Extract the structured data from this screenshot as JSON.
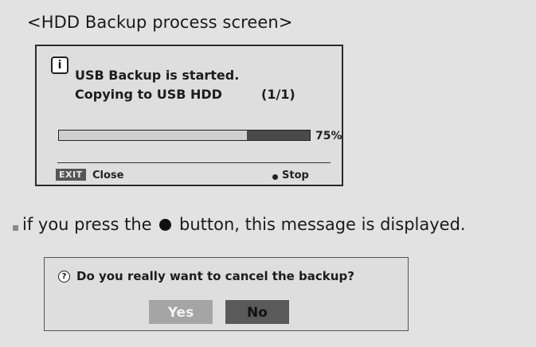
{
  "heading": "<HDD Backup process screen>",
  "backup_dialog": {
    "info_icon": "i",
    "message_line1": "USB Backup is started.",
    "message_line2": "Copying to USB HDD",
    "count": "(1/1)",
    "progress_fraction": 0.75,
    "progress_label": "75%",
    "exit_key": "EXIT",
    "close_label": "Close",
    "stop_label": "Stop"
  },
  "instruction": {
    "before": "if you press the",
    "after": "button, this message is displayed."
  },
  "cancel_dialog": {
    "question_icon": "?",
    "question": "Do you really want to cancel the backup?",
    "yes_label": "Yes",
    "no_label": "No"
  },
  "colors": {
    "background": "#e2e2e2",
    "progress_fill": "#4a4a4a",
    "yes_button": "#a5a5a5",
    "no_button": "#5a5a5a"
  }
}
